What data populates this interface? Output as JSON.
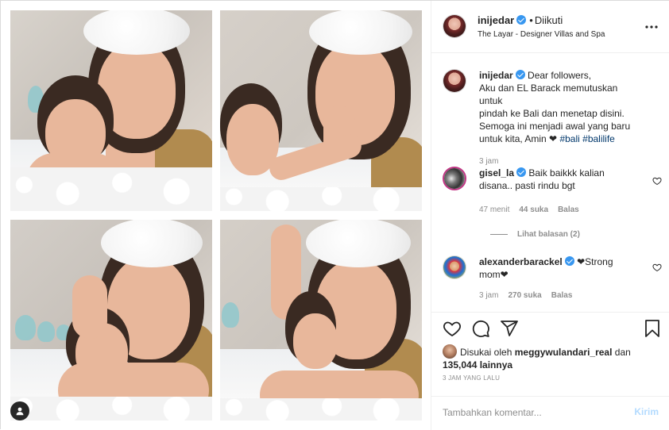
{
  "post": {
    "username": "inijedar",
    "follow_status": "Diikuti",
    "location": "The Layar - Designer Villas and Spa",
    "caption_lines": [
      "Dear followers,",
      "Aku dan EL Barack memutuskan untuk",
      "pindah ke Bali dan menetap disini.",
      "Semoga ini menjadi awal yang baru",
      "untuk kita, Amin ❤"
    ],
    "hashtags": [
      "#bali",
      "#balilife"
    ],
    "caption_time": "3 jam"
  },
  "comments": [
    {
      "username": "gisel_la",
      "text_line1": "Baik baikkk kalian",
      "text_line2": "disana.. pasti rindu bgt",
      "time": "47 menit",
      "likes": "44 suka",
      "reply": "Balas",
      "view_replies": "Lihat balasan (2)"
    },
    {
      "username": "alexanderbarackel",
      "text_line1": "❤Strong",
      "text_line2": "mom❤",
      "time": "3 jam",
      "likes": "270 suka",
      "reply": "Balas"
    }
  ],
  "likes": {
    "prefix": "Disukai oleh",
    "user": "meggywulandari_real",
    "connector": "dan",
    "count": "135,044 lainnya"
  },
  "timestamp": "3 JAM YANG LALU",
  "composer": {
    "placeholder": "Tambahkan komentar...",
    "send_label": "Kirim"
  },
  "icons": {
    "more": "more-options-icon",
    "like": "heart-icon",
    "comment": "comment-icon",
    "share": "share-icon",
    "save": "bookmark-icon",
    "user_tag": "user-tag-icon"
  },
  "colors": {
    "link": "#00376b",
    "verified": "#3897f0",
    "send_disabled": "#b3dbff"
  }
}
